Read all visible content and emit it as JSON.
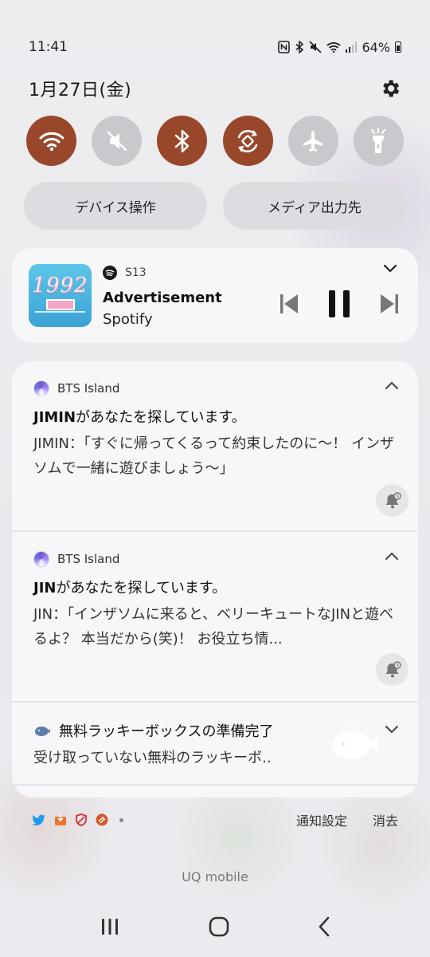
{
  "status_bar": {
    "time": "11:41",
    "battery": "64%"
  },
  "header": {
    "date": "1月27日(金)"
  },
  "quick_toggles": [
    {
      "name": "wifi",
      "state": "on"
    },
    {
      "name": "mute",
      "state": "off"
    },
    {
      "name": "bluetooth",
      "state": "on"
    },
    {
      "name": "auto-rotate",
      "state": "on"
    },
    {
      "name": "airplane",
      "state": "off"
    },
    {
      "name": "flashlight",
      "state": "off"
    }
  ],
  "pills": {
    "device_control": "デバイス操作",
    "media_output": "メディア出力先"
  },
  "media": {
    "app_label": "S13",
    "title": "Advertisement",
    "artist": "Spotify",
    "art_year": "1992",
    "accent": "#1a1a1a"
  },
  "notifications": [
    {
      "app": "BTS Island",
      "title_bold": "JIMIN",
      "title_rest": "があなたを探しています。",
      "body": "JIMIN：「すぐに帰ってくるって約束したのに～！ インザソムで一緒に遊びましょう～」"
    },
    {
      "app": "BTS Island",
      "title_bold": "JIN",
      "title_rest": "があなたを探しています。",
      "body": "JIN：「インザソムに来ると、ベリーキュートなJINと遊べるよ？ 本当だから(笑)！ お役立ち情..."
    },
    {
      "app": "",
      "title": "無料ラッキーボックスの準備完了",
      "body": "受け取っていない無料のラッキーボ.."
    }
  ],
  "footer": {
    "notification_settings": "通知設定",
    "clear": "消去"
  },
  "carrier": "UQ mobile",
  "colors": {
    "toggle_on": "#99472b",
    "toggle_off": "#c9c8cd",
    "panel_bg": "#f7f7f9"
  }
}
